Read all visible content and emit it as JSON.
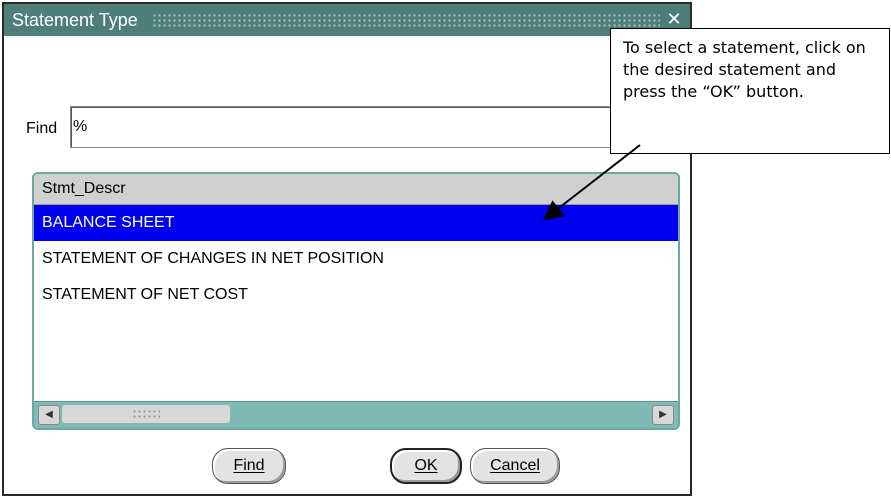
{
  "dialog": {
    "title": "Statement Type",
    "close_glyph": "✕",
    "find_label": "Find",
    "find_value": "%",
    "list": {
      "header": "Stmt_Descr",
      "rows": [
        "BALANCE SHEET",
        "STATEMENT OF CHANGES IN NET POSITION",
        "STATEMENT OF NET COST"
      ],
      "selected_index": 0
    },
    "buttons": {
      "find": "Find",
      "ok": "OK",
      "cancel": "Cancel"
    }
  },
  "callout": {
    "text": "To select a statement, click on the desired statement and press the “OK” button."
  },
  "colors": {
    "titlebar": "#4d7f78",
    "selection": "#0000ee",
    "scrollbar": "#7fbab4"
  },
  "icons": {
    "close": "close-icon",
    "scroll_left": "arrow-left-icon",
    "scroll_right": "arrow-right-icon"
  }
}
